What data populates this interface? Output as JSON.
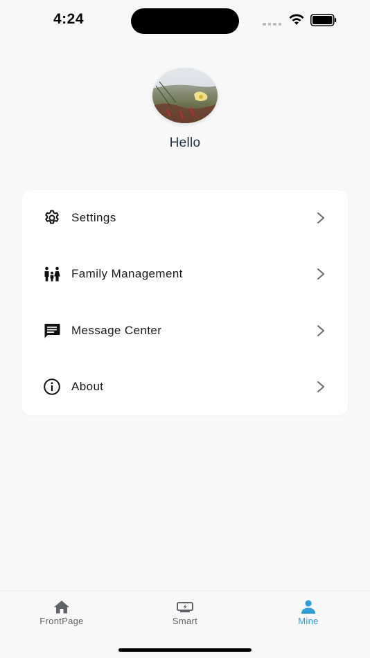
{
  "status_bar": {
    "time": "4:24"
  },
  "profile": {
    "greeting": "Hello"
  },
  "menu": {
    "items": [
      {
        "label": "Settings",
        "icon": "gear-icon"
      },
      {
        "label": "Family Management",
        "icon": "family-icon"
      },
      {
        "label": "Message Center",
        "icon": "message-icon"
      },
      {
        "label": "About",
        "icon": "info-icon"
      }
    ]
  },
  "tab_bar": {
    "tabs": [
      {
        "label": "FrontPage",
        "icon": "home-icon",
        "active": false
      },
      {
        "label": "Smart",
        "icon": "smart-device-icon",
        "active": false
      },
      {
        "label": "Mine",
        "icon": "person-icon",
        "active": true
      }
    ]
  },
  "colors": {
    "accent": "#2e9fd8",
    "background": "#f8f8f9",
    "card": "#ffffff",
    "greeting": "#1f2d45"
  }
}
